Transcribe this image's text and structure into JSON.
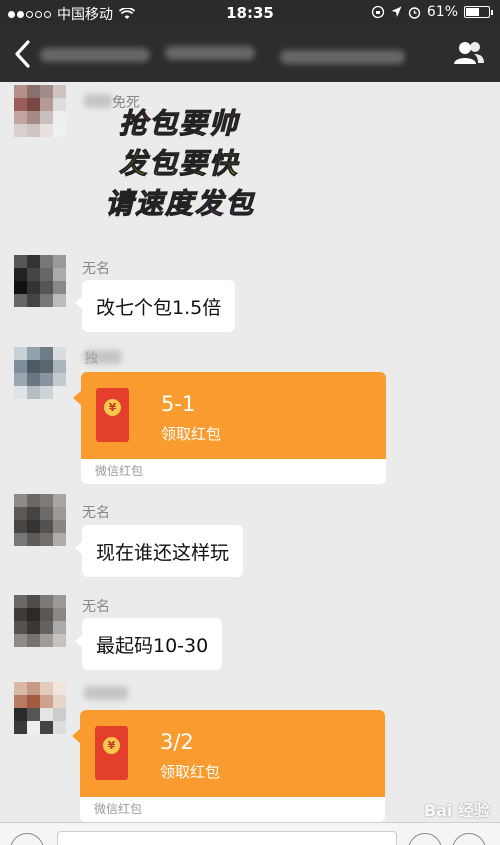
{
  "status_bar": {
    "carrier": "中国移动",
    "time": "18:35",
    "battery": "61%",
    "battery_level": 0.61
  },
  "nav": {
    "back_icon": "chevron-left-icon",
    "contacts_icon": "group-contacts-icon"
  },
  "messages": [
    {
      "sender": "免死",
      "type": "sticker",
      "lines": [
        "抢包要帅",
        "发包要快",
        "请速度发包"
      ]
    },
    {
      "sender": "无名",
      "type": "text",
      "text": "改七个包1.5倍"
    },
    {
      "sender": "独",
      "type": "redpacket",
      "title": "5-1",
      "subtitle": "领取红包",
      "footer": "微信红包"
    },
    {
      "sender": "无名",
      "type": "text",
      "text": "现在谁还这样玩"
    },
    {
      "sender": "无名",
      "type": "text",
      "text": "最起码10-30"
    },
    {
      "sender": "",
      "type": "redpacket",
      "title": "3/2",
      "subtitle": "领取红包",
      "footer": "微信红包"
    }
  ],
  "watermark": "Bai 经验",
  "colors": {
    "nav_bg": "#2d2d30",
    "chat_bg": "#ebebeb",
    "redpacket": "#f99b2e",
    "envelope": "#e43f2c",
    "sticker": [
      "#ff3fa4",
      "#ffd600",
      "#a24bff"
    ]
  }
}
